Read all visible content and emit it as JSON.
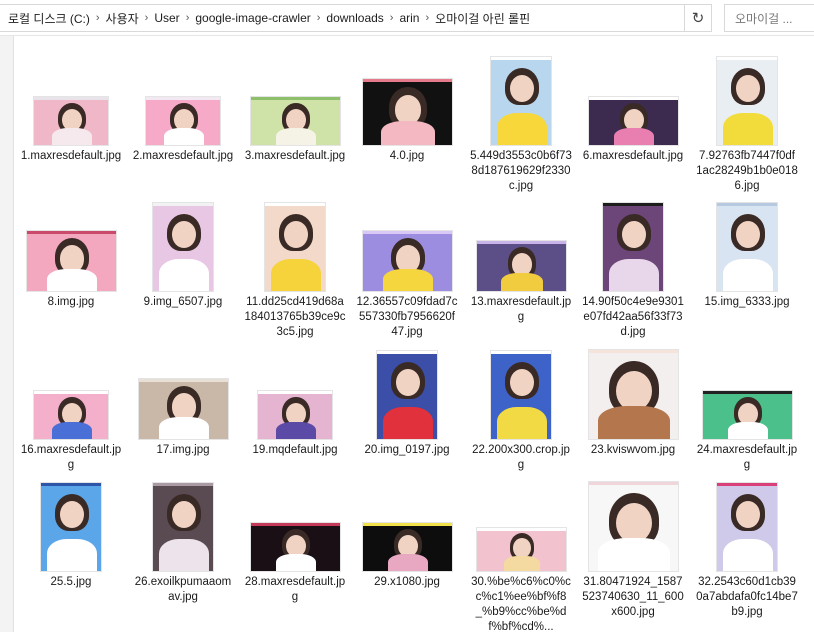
{
  "breadcrumb": [
    "로컬 디스크 (C:)",
    "사용자",
    "User",
    "google-image-crawler",
    "downloads",
    "arin",
    "오마이걸 아린 롤핀"
  ],
  "search": {
    "placeholder": "오마이걸 ..."
  },
  "icons": {
    "separator": "chevron-right-icon",
    "dropdown": "chevron-down-icon",
    "refresh": "refresh-icon",
    "search": "search-icon"
  },
  "files": [
    {
      "name": "1.maxresdefault.jpg",
      "bg": "#f0b7c8",
      "accent": "#f6e9ee",
      "top": "#e8e4ea"
    },
    {
      "name": "2.maxresdefault.jpg",
      "bg": "#f7a9c8",
      "accent": "#ffffff",
      "top": "#f3e9f3"
    },
    {
      "name": "3.maxresdefault.jpg",
      "bg": "#cfe3a8",
      "accent": "#f5f2e6",
      "top": "#8ec06c"
    },
    {
      "name": "4.0.jpg",
      "bg": "#111111",
      "accent": "#f4b8c2",
      "top": "#e57a8a"
    },
    {
      "name": "5.449d3553c0b6f738d187619629f2330c.jpg",
      "bg": "#b8d7ef",
      "accent": "#f7d73a",
      "top": "#ffffff"
    },
    {
      "name": "6.maxresdefault.jpg",
      "bg": "#3d2b4f",
      "accent": "#e87fb0",
      "top": "#ffffff"
    },
    {
      "name": "7.92763fb7447f0df1ac28249b1b0e0186.jpg",
      "bg": "#e9eef2",
      "accent": "#f2dc3c",
      "top": "#ffffff"
    },
    {
      "name": "8.img.jpg",
      "bg": "#f4a8c0",
      "accent": "#ffffff",
      "top": "#c94a6a"
    },
    {
      "name": "9.img_6507.jpg",
      "bg": "#e7c7e4",
      "accent": "#ffffff",
      "top": "#f2f2f2"
    },
    {
      "name": "11.dd25cd419d68a184013765b39ce9c3c5.jpg",
      "bg": "#f3d9c9",
      "accent": "#f6d33a",
      "top": "#ffffff"
    },
    {
      "name": "12.36557c09fdad7c557330fb7956620f47.jpg",
      "bg": "#9d8de0",
      "accent": "#f6d63f",
      "top": "#d9c7f5"
    },
    {
      "name": "13.maxresdefault.jpg",
      "bg": "#5c4e86",
      "accent": "#f1cc3e",
      "top": "#c8b4e8"
    },
    {
      "name": "14.90f50c4e9e9301e07fd42aa56f33f73d.jpg",
      "bg": "#6c4678",
      "accent": "#e8d7ea",
      "top": "#1d1d1d"
    },
    {
      "name": "15.img_6333.jpg",
      "bg": "#d8e4f1",
      "accent": "#ffffff",
      "top": "#b7c9e0"
    },
    {
      "name": "16.maxresdefault.jpg",
      "bg": "#f4b0ca",
      "accent": "#4a6fd6",
      "top": "#ffffff"
    },
    {
      "name": "17.img.jpg",
      "bg": "#c9b8a8",
      "accent": "#ffffff",
      "top": "#e7e0d6"
    },
    {
      "name": "19.mqdefault.jpg",
      "bg": "#e4b4d0",
      "accent": "#5b4aa6",
      "top": "#ffffff"
    },
    {
      "name": "20.img_0197.jpg",
      "bg": "#3b4ea8",
      "accent": "#e0313d",
      "top": "#ffffff"
    },
    {
      "name": "22.200x300.crop.jpg",
      "bg": "#3e63c8",
      "accent": "#f2da45",
      "top": "#ffffff"
    },
    {
      "name": "23.kviswvom.jpg",
      "bg": "#f3efee",
      "accent": "#b4764c",
      "top": "#f6e3da"
    },
    {
      "name": "24.maxresdefault.jpg",
      "bg": "#4cc08a",
      "accent": "#ffffff",
      "top": "#222222"
    },
    {
      "name": "25.5.jpg",
      "bg": "#5aa6e8",
      "accent": "#ffffff",
      "top": "#2d56a8"
    },
    {
      "name": "26.exoilkpumaaomav.jpg",
      "bg": "#5a4a52",
      "accent": "#ece4ea",
      "top": "#a99aa4"
    },
    {
      "name": "28.maxresdefault.jpg",
      "bg": "#1a0f14",
      "accent": "#ffffff",
      "top": "#c43a58"
    },
    {
      "name": "29.x1080.jpg",
      "bg": "#0d0d0d",
      "accent": "#e9a8c2",
      "top": "#f2e14a"
    },
    {
      "name": "30.%be%c6%c0%cc%c1%ee%bf%f8_%b9%cc%be%df%bf%cd%...",
      "bg": "#f2c3cf",
      "accent": "#f4d9a0",
      "top": "#ffffff"
    },
    {
      "name": "31.80471924_1587523740630_11_600x600.jpg",
      "bg": "#f7f7f7",
      "accent": "#ffffff",
      "top": "#f0d6da"
    },
    {
      "name": "32.2543c60d1cb390a7abdafa0fc14be7b9.jpg",
      "bg": "#cfc9ea",
      "accent": "#ffffff",
      "top": "#d9407a"
    }
  ]
}
